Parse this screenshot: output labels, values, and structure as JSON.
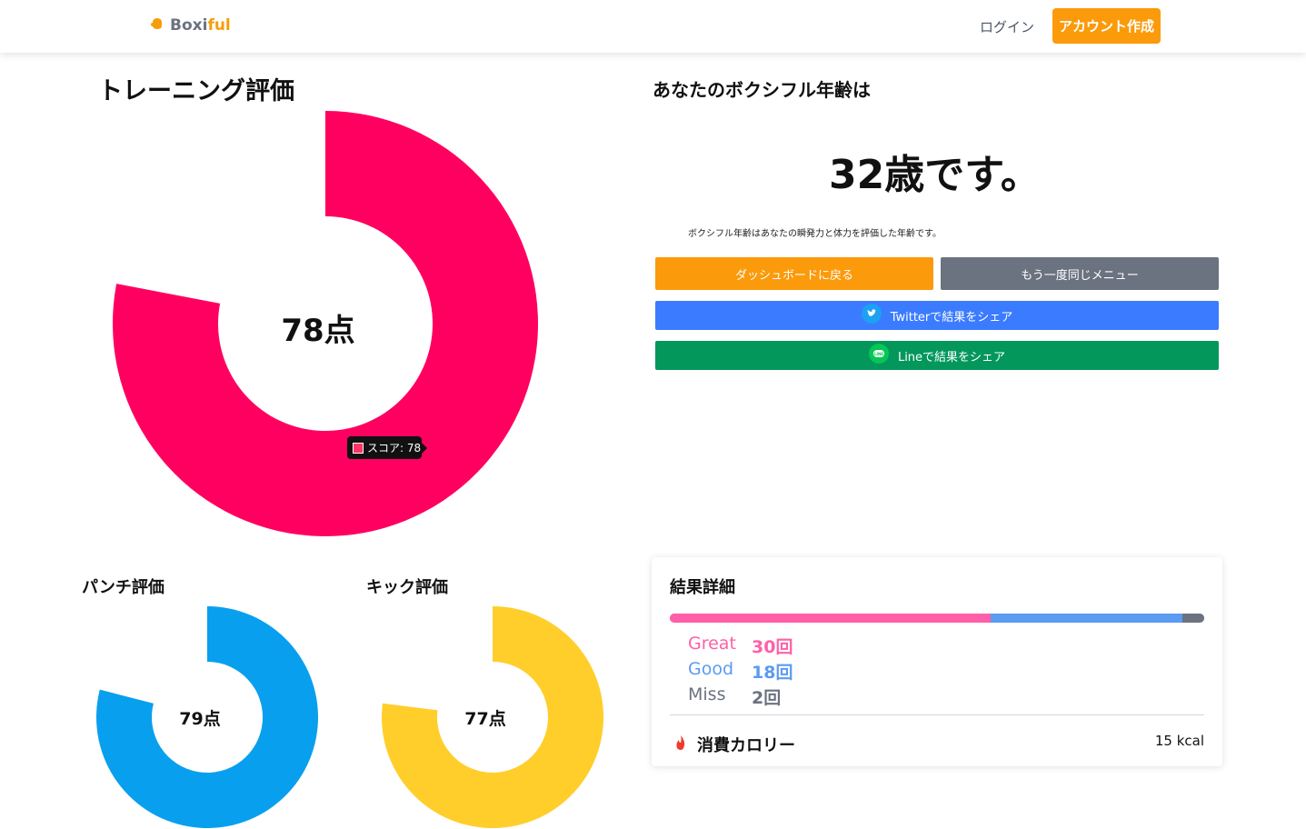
{
  "header": {
    "brand_part1": "Boxi",
    "brand_part2": "ful",
    "login_label": "ログイン",
    "signup_label": "アカウント作成"
  },
  "training": {
    "title": "トレーニング評価",
    "score_text": "78点",
    "tooltip_text": "スコア: 78"
  },
  "age": {
    "title": "あなたのボクシフル年齢は",
    "value_text": "32歳です。",
    "description": "ボクシフル年齢はあなたの瞬発力と体力を評価した年齢です。"
  },
  "buttons": {
    "dashboard": "ダッシュボードに戻る",
    "retry": "もう一度同じメニュー",
    "twitter": "Twitterで結果をシェア",
    "line": "Lineで結果をシェア"
  },
  "punch": {
    "title": "パンチ評価",
    "score_text": "79点"
  },
  "kick": {
    "title": "キック評価",
    "score_text": "77点"
  },
  "details": {
    "title": "結果詳細",
    "great_label": "Great",
    "great_count": "30回",
    "good_label": "Good",
    "good_count": "18回",
    "miss_label": "Miss",
    "miss_count": "2回",
    "calories_label": "消費カロリー",
    "calories_value": "15 kcal"
  },
  "colors": {
    "main": "#ff0060",
    "punch": "#08a0ee",
    "kick": "#ffce2b",
    "accent": "#fb9a0b",
    "great": "#ff5fa8",
    "good": "#5b9bf2",
    "miss": "#6b7280"
  },
  "chart_data": [
    {
      "type": "pie",
      "title": "トレーニング評価",
      "series": [
        {
          "name": "スコア",
          "values": [
            78
          ]
        }
      ],
      "max": 100
    },
    {
      "type": "pie",
      "title": "パンチ評価",
      "values": [
        79
      ],
      "max": 100
    },
    {
      "type": "pie",
      "title": "キック評価",
      "values": [
        77
      ],
      "max": 100
    },
    {
      "type": "bar",
      "title": "結果詳細",
      "categories": [
        "Great",
        "Good",
        "Miss"
      ],
      "values": [
        30,
        18,
        2
      ]
    }
  ]
}
